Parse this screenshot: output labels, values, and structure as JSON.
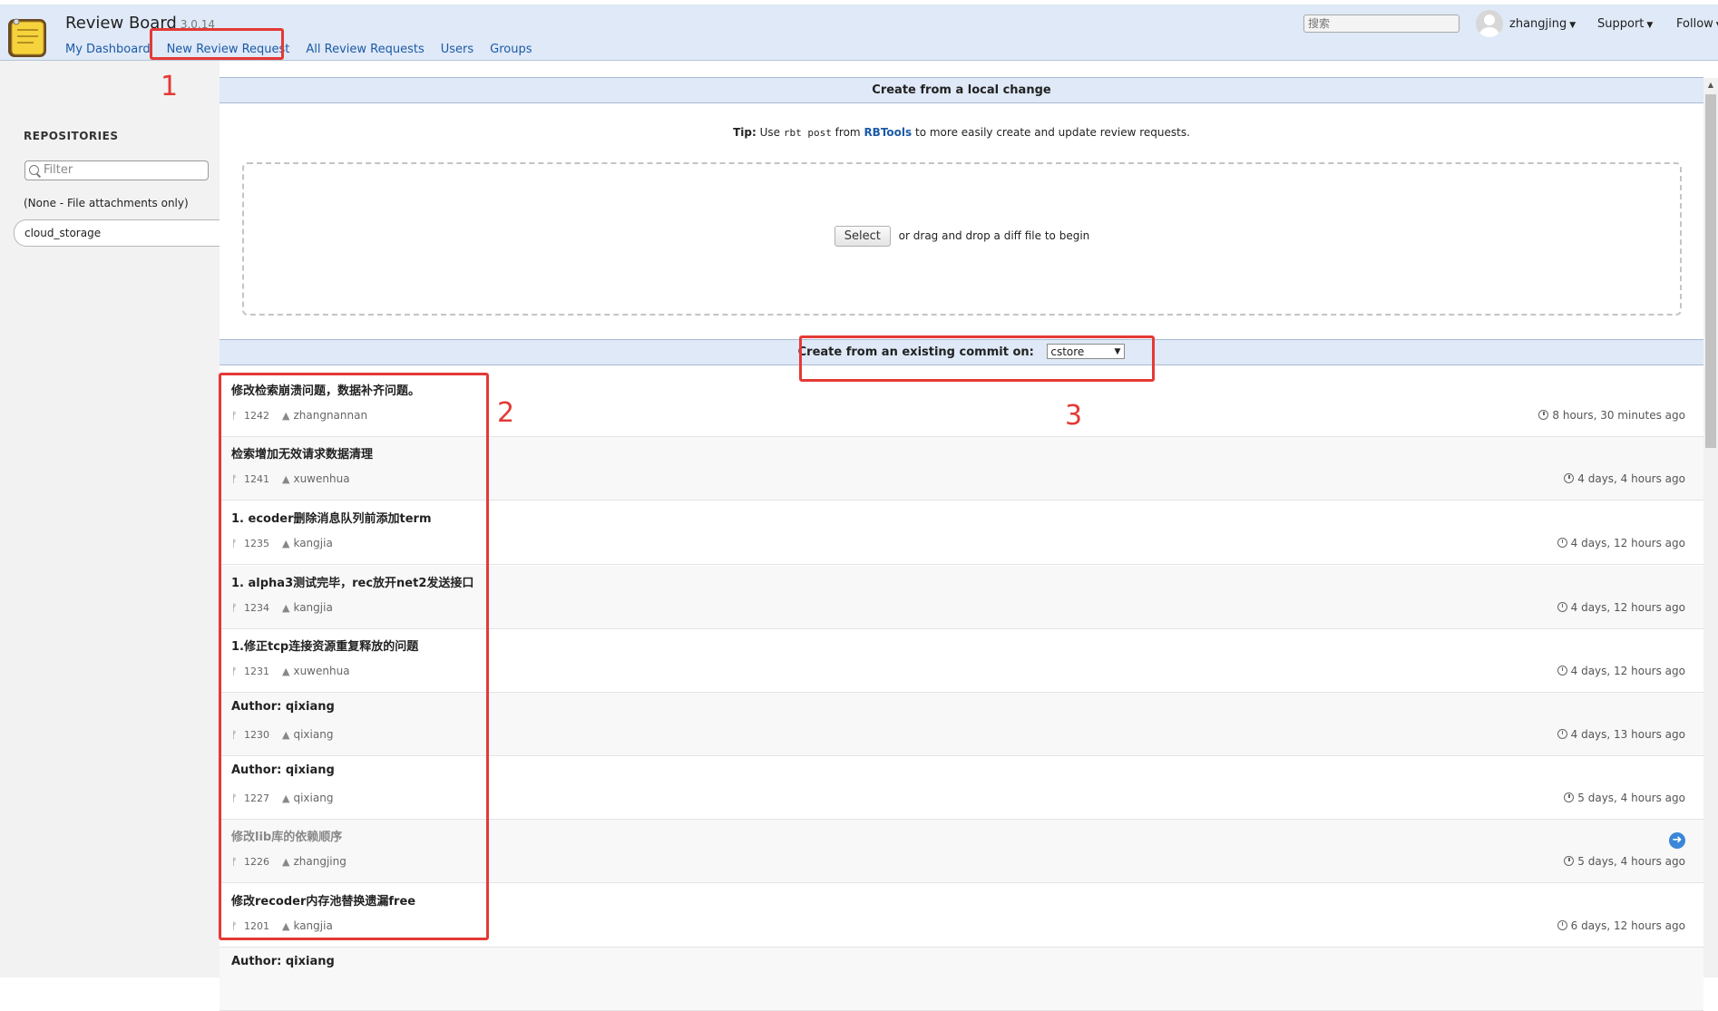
{
  "app": {
    "title": "Review Board",
    "version": "3.0.14",
    "nav": [
      "My Dashboard",
      "New Review Request",
      "All Review Requests",
      "Users",
      "Groups"
    ],
    "search_placeholder": "搜索",
    "user": "zhangjing",
    "support": "Support",
    "follow": "Follow"
  },
  "sidebar": {
    "heading": "REPOSITORIES",
    "filter_placeholder": "Filter",
    "none_item": "(None - File attachments only)",
    "selected_repo": "cloud_storage"
  },
  "local_change": {
    "header": "Create from a local change",
    "tip_label": "Tip:",
    "tip_use": "Use",
    "tip_command": "rbt post",
    "tip_from": "from",
    "tip_link": "RBTools",
    "tip_rest": "to more easily create and update review requests.",
    "select_button": "Select",
    "drop_text": "or drag and drop a diff file to begin"
  },
  "existing_commit": {
    "header": "Create from an existing commit on:",
    "branch": "cstore"
  },
  "commits": [
    {
      "title": "修改检索崩溃问题，数据补齐问题。",
      "id": "1242",
      "author": "zhangnannan",
      "time": "8 hours, 30 minutes ago",
      "muted": false
    },
    {
      "title": "检索增加无效请求数据清理",
      "id": "1241",
      "author": "xuwenhua",
      "time": "4 days, 4 hours ago",
      "muted": false
    },
    {
      "title": "1. ecoder删除消息队列前添加term",
      "id": "1235",
      "author": "kangjia",
      "time": "4 days, 12 hours ago",
      "muted": false
    },
    {
      "title": "1. alpha3测试完毕，rec放开net2发送接口",
      "id": "1234",
      "author": "kangjia",
      "time": "4 days, 12 hours ago",
      "muted": false
    },
    {
      "title": "1.修正tcp连接资源重复释放的问题",
      "id": "1231",
      "author": "xuwenhua",
      "time": "4 days, 12 hours ago",
      "muted": false
    },
    {
      "title": "Author: qixiang",
      "id": "1230",
      "author": "qixiang",
      "time": "4 days, 13 hours ago",
      "muted": false
    },
    {
      "title": "Author: qixiang",
      "id": "1227",
      "author": "qixiang",
      "time": "5 days, 4 hours ago",
      "muted": false
    },
    {
      "title": "修改lib库的依赖顺序",
      "id": "1226",
      "author": "zhangjing",
      "time": "5 days, 4 hours ago",
      "muted": true
    },
    {
      "title": "修改recoder内存池替换遗漏free",
      "id": "1201",
      "author": "kangjia",
      "time": "6 days, 12 hours ago",
      "muted": false
    },
    {
      "title": "Author: qixiang",
      "id": "",
      "author": "",
      "time": "",
      "muted": false
    }
  ],
  "annotations": [
    "1",
    "2",
    "3"
  ],
  "colors": {
    "accent": "#1b5aa6",
    "annotation": "#e53935",
    "header_bg": "#dfe9f7"
  }
}
